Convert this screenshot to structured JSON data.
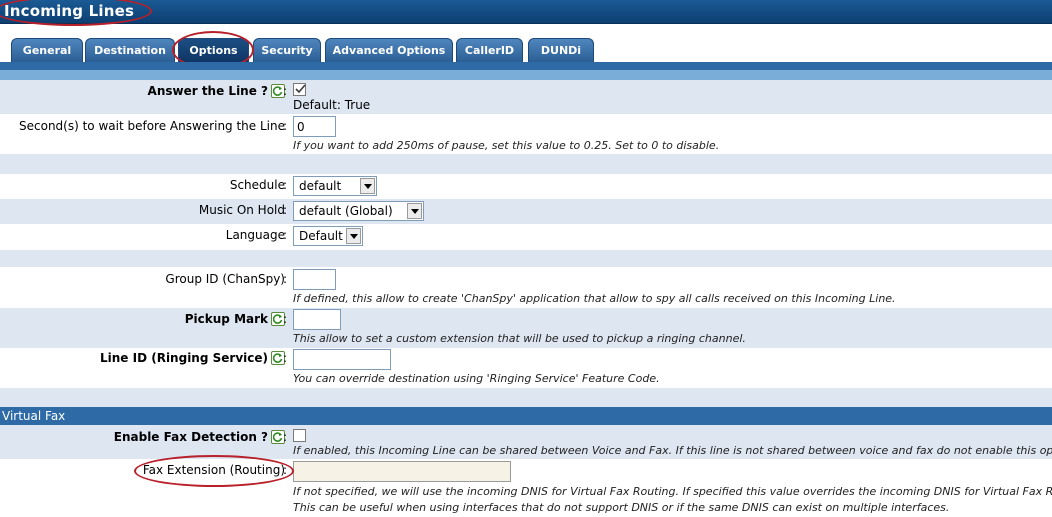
{
  "window": {
    "title": "Incoming Lines"
  },
  "tabs": [
    {
      "label": "General"
    },
    {
      "label": "Destination"
    },
    {
      "label": "Options"
    },
    {
      "label": "Security"
    },
    {
      "label": "Advanced Options"
    },
    {
      "label": "CallerID"
    },
    {
      "label": "DUNDi"
    }
  ],
  "active_tab": "Options",
  "colors": {
    "header": "#0d3f72",
    "tab": "#2b5f95",
    "row_alt": "#dde6f1",
    "annotation": "#b8202a"
  },
  "colon": ":",
  "fields": {
    "answer_line": {
      "label": "Answer the Line ?",
      "checked": true,
      "default_text": "Default: True"
    },
    "wait_seconds": {
      "label": "Second(s) to wait before Answering the Line",
      "value": "0",
      "hint": "If you want to add 250ms of pause, set this value to 0.25. Set to 0 to disable."
    },
    "schedule": {
      "label": "Schedule",
      "value": "default"
    },
    "music_on_hold": {
      "label": "Music On Hold",
      "value": "default (Global)"
    },
    "language": {
      "label": "Language",
      "value": "Default"
    },
    "group_id": {
      "label": "Group ID (ChanSpy)",
      "value": "",
      "hint": "If defined, this allow to create 'ChanSpy' application that allow to spy all calls received on this Incoming Line."
    },
    "pickup_mark": {
      "label": "Pickup Mark",
      "value": "",
      "hint": "This allow to set a custom extension that will be used to pickup a ringing channel."
    },
    "line_id": {
      "label": "Line ID (Ringing Service)",
      "value": "",
      "hint": "You can override destination using 'Ringing Service' Feature Code."
    }
  },
  "virtual_fax": {
    "section_title": "Virtual Fax",
    "enable_fax": {
      "label": "Enable Fax Detection ?",
      "checked": false,
      "hint": "If enabled, this Incoming Line can be shared between Voice and Fax. If this line is not shared between voice and fax do not enable this option."
    },
    "fax_extension": {
      "label": "Fax Extension (Routing)",
      "value": "",
      "hint_line1": "If not specified, we will use the incoming DNIS for Virtual Fax Routing. If specified this value overrides the incoming DNIS for Virtual Fax Routing.",
      "hint_line2": "This can be useful when using interfaces that do not support DNIS or if the same DNIS can exist on multiple interfaces."
    }
  },
  "icons": {
    "refresh": "refresh-icon",
    "checkmark": "checkmark-icon",
    "dropdown": "chevron-down-icon"
  }
}
